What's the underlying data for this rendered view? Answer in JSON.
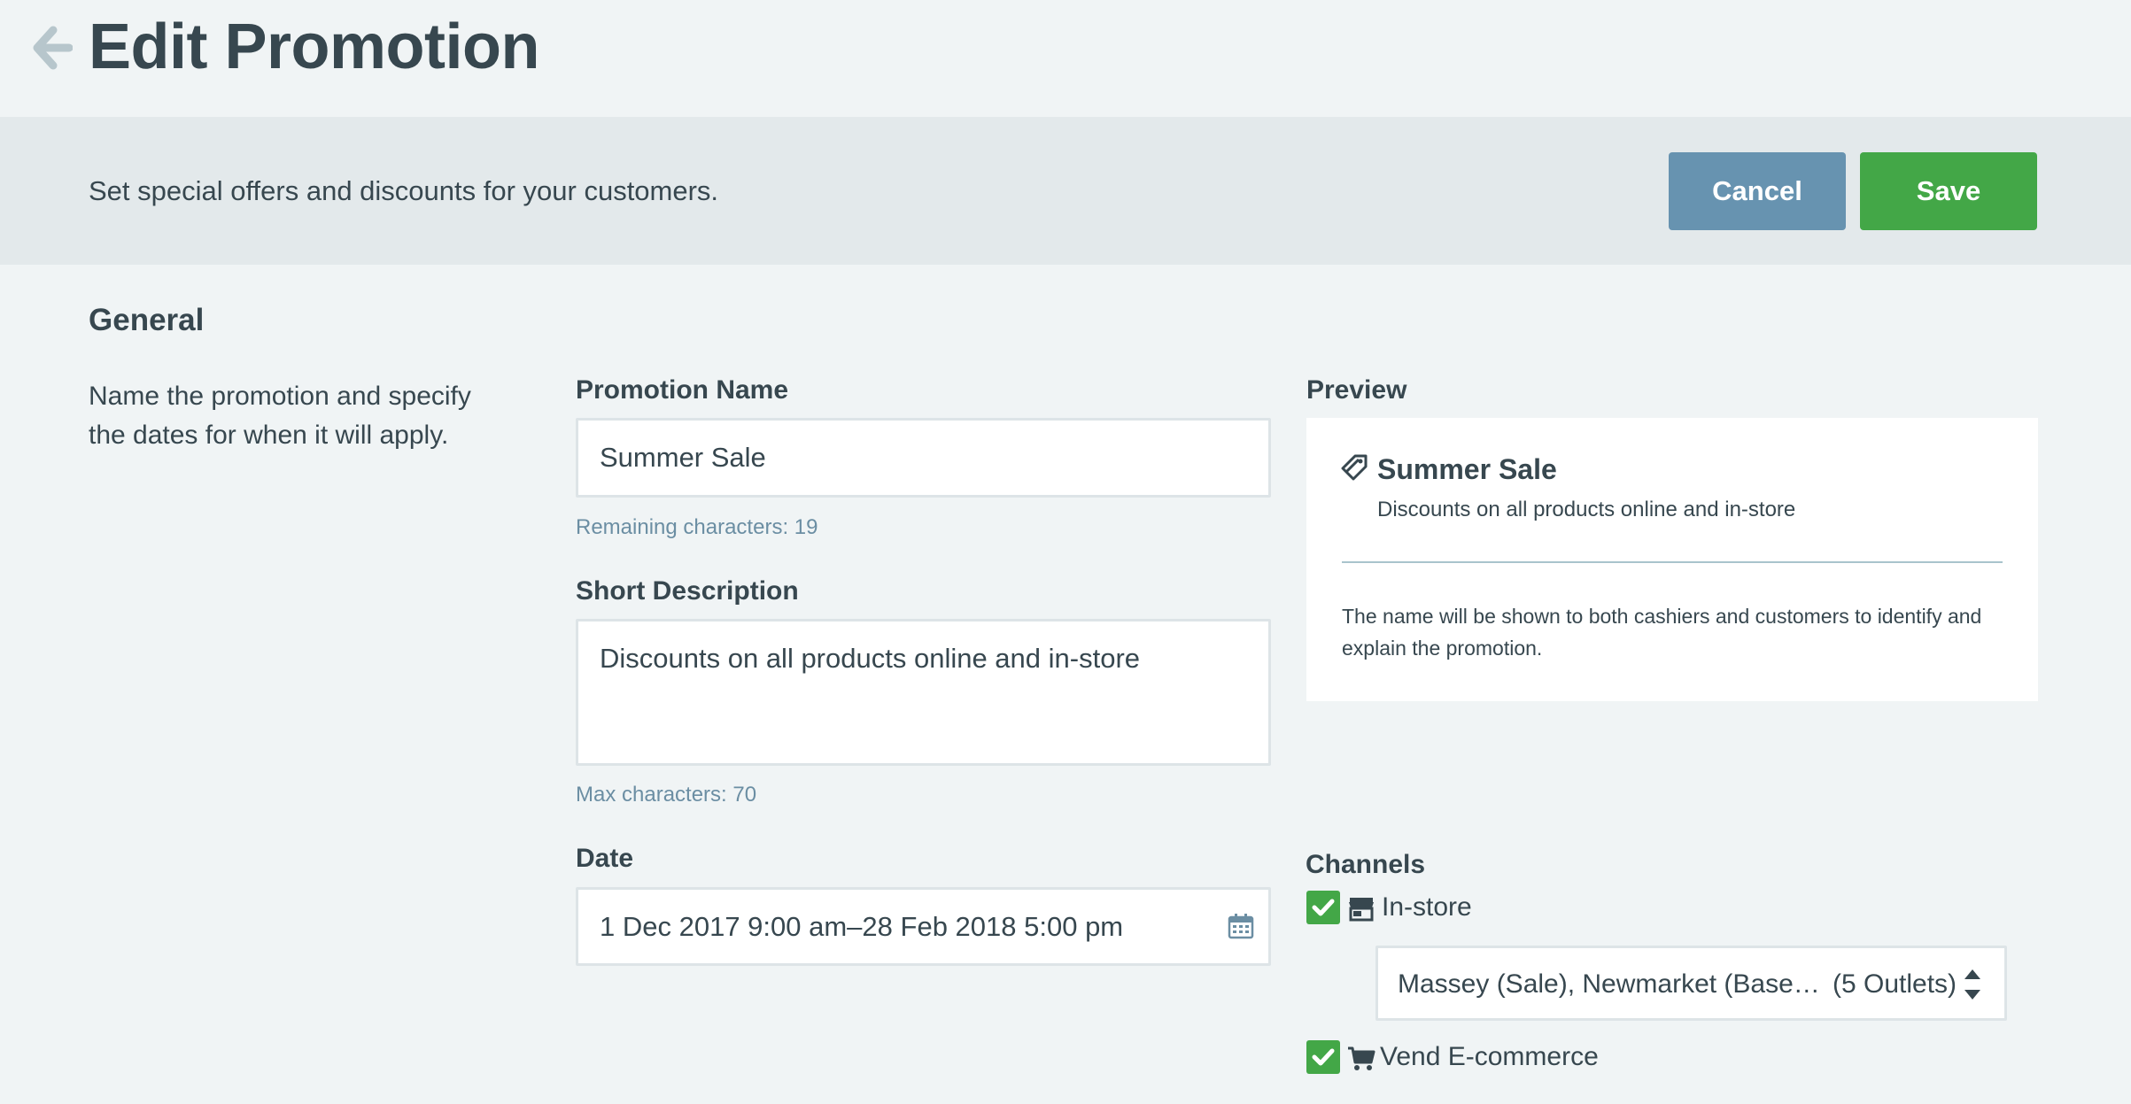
{
  "header": {
    "title": "Edit Promotion",
    "back_icon": "arrow-left-icon"
  },
  "toolbar": {
    "description": "Set special offers and discounts for your customers.",
    "cancel_label": "Cancel",
    "save_label": "Save"
  },
  "general": {
    "title": "General",
    "description": "Name the promotion and specify the dates for when it will apply."
  },
  "form": {
    "name_label": "Promotion Name",
    "name_value": "Summer Sale",
    "name_hint": "Remaining characters: 19",
    "desc_label": "Short Description",
    "desc_value": "Discounts on all products online and in-store",
    "desc_hint": "Max characters: 70",
    "date_label": "Date",
    "date_value": "1 Dec 2017 9:00 am–28 Feb 2018 5:00 pm",
    "date_icon": "calendar-icon"
  },
  "preview": {
    "label": "Preview",
    "icon": "tag-icon",
    "name": "Summer Sale",
    "description": "Discounts on all products online and in-store",
    "note": "The name will be shown to both cashiers and customers to identify and explain the promotion."
  },
  "channels": {
    "label": "Channels",
    "items": [
      {
        "label": "In-store",
        "checked": true,
        "icon": "store-icon"
      },
      {
        "label": "Vend E-commerce",
        "checked": true,
        "icon": "cart-icon"
      }
    ],
    "outlets": {
      "text": "Massey (Sale), Newmarket (Base), Se...",
      "count": "(5 Outlets)"
    }
  },
  "colors": {
    "background": "#f0f4f5",
    "toolbar": "#e3e9eb",
    "cancel": "#6793b0",
    "save": "#43a747",
    "hint": "#6b8ea3"
  }
}
